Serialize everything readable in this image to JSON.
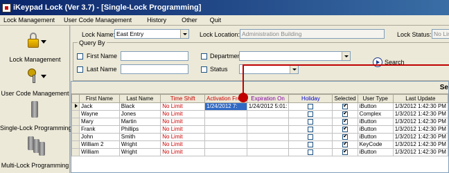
{
  "window": {
    "title": "iKeypad Lock (Ver 3.7) - [Single-Lock Programming]"
  },
  "menu": [
    "Lock Management",
    "User Code Management",
    "History",
    "Other",
    "Quit"
  ],
  "sidebar": {
    "items": [
      {
        "label": "Lock Management",
        "icon": "lock-icon"
      },
      {
        "label": "User Code Management",
        "icon": "key-icon"
      },
      {
        "label": "Single-Lock Programming",
        "icon": "keypad-icon"
      },
      {
        "label": "Multi-Lock Programming",
        "icon": "multi-keypad-icon"
      }
    ]
  },
  "lock": {
    "name_label": "Lock Name:",
    "name_value": "East Entry",
    "location_label": "Lock Location:",
    "location_value": "Administration Building",
    "status_label": "Lock Status:",
    "status_value": "No Lim"
  },
  "query": {
    "legend": "Query By",
    "first_name_label": "First Name",
    "last_name_label": "Last Name",
    "department_label": "Department",
    "status_label": "Status",
    "search_label": "Search"
  },
  "grid": {
    "caption": "Se",
    "columns": [
      "First Name",
      "Last Name",
      "Time Shift",
      "Activation From",
      "Expiration On",
      "Holiday",
      "Selected",
      "User Type",
      "Last Update"
    ],
    "column_colors": [
      "#000000",
      "#000000",
      "#cc0000",
      "#cc0000",
      "#8000a0",
      "#0000cc",
      "#000000",
      "#000000",
      "#000000"
    ],
    "rows": [
      {
        "first": "Jack",
        "last": "Black",
        "shift": "No Limit",
        "from": "1/24/2012 7:",
        "exp": "1/24/2012 5:01:",
        "holiday": false,
        "selected": true,
        "type": "iButton",
        "updated": "1/3/2012 1:42:30 PM"
      },
      {
        "first": "Wayne",
        "last": "Jones",
        "shift": "No Limit",
        "from": "",
        "exp": "",
        "holiday": false,
        "selected": true,
        "type": "Complex",
        "updated": "1/3/2012 1:42:30 PM"
      },
      {
        "first": "Mary",
        "last": "Martin",
        "shift": "No Limit",
        "from": "",
        "exp": "",
        "holiday": false,
        "selected": true,
        "type": "iButton",
        "updated": "1/3/2012 1:42:30 PM"
      },
      {
        "first": "Frank",
        "last": "Phillips",
        "shift": "No Limit",
        "from": "",
        "exp": "",
        "holiday": false,
        "selected": true,
        "type": "iButton",
        "updated": "1/3/2012 1:42:30 PM"
      },
      {
        "first": "John",
        "last": "Smith",
        "shift": "No Limit",
        "from": "",
        "exp": "",
        "holiday": false,
        "selected": true,
        "type": "iButton",
        "updated": "1/3/2012 1:42:30 PM"
      },
      {
        "first": "William 2",
        "last": "Wright",
        "shift": "No Limit",
        "from": "",
        "exp": "",
        "holiday": false,
        "selected": true,
        "type": "KeyCode",
        "updated": "1/3/2012 1:42:30 PM"
      },
      {
        "first": "William",
        "last": "Wright",
        "shift": "No Limit",
        "from": "",
        "exp": "",
        "holiday": false,
        "selected": true,
        "type": "iButton",
        "updated": "1/3/2012 1:42:30 PM"
      }
    ]
  },
  "colors": {
    "annotation": "#c00000",
    "shift_text": "#cc0000",
    "selection": "#316ac5"
  }
}
